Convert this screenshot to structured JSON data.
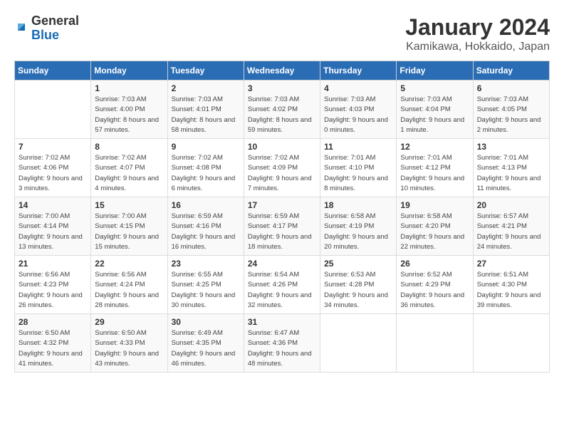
{
  "logo": {
    "text_general": "General",
    "text_blue": "Blue"
  },
  "header": {
    "month": "January 2024",
    "location": "Kamikawa, Hokkaido, Japan"
  },
  "weekdays": [
    "Sunday",
    "Monday",
    "Tuesday",
    "Wednesday",
    "Thursday",
    "Friday",
    "Saturday"
  ],
  "weeks": [
    [
      {
        "day": "",
        "sunrise": "",
        "sunset": "",
        "daylight": ""
      },
      {
        "day": "1",
        "sunrise": "Sunrise: 7:03 AM",
        "sunset": "Sunset: 4:00 PM",
        "daylight": "Daylight: 8 hours and 57 minutes."
      },
      {
        "day": "2",
        "sunrise": "Sunrise: 7:03 AM",
        "sunset": "Sunset: 4:01 PM",
        "daylight": "Daylight: 8 hours and 58 minutes."
      },
      {
        "day": "3",
        "sunrise": "Sunrise: 7:03 AM",
        "sunset": "Sunset: 4:02 PM",
        "daylight": "Daylight: 8 hours and 59 minutes."
      },
      {
        "day": "4",
        "sunrise": "Sunrise: 7:03 AM",
        "sunset": "Sunset: 4:03 PM",
        "daylight": "Daylight: 9 hours and 0 minutes."
      },
      {
        "day": "5",
        "sunrise": "Sunrise: 7:03 AM",
        "sunset": "Sunset: 4:04 PM",
        "daylight": "Daylight: 9 hours and 1 minute."
      },
      {
        "day": "6",
        "sunrise": "Sunrise: 7:03 AM",
        "sunset": "Sunset: 4:05 PM",
        "daylight": "Daylight: 9 hours and 2 minutes."
      }
    ],
    [
      {
        "day": "7",
        "sunrise": "Sunrise: 7:02 AM",
        "sunset": "Sunset: 4:06 PM",
        "daylight": "Daylight: 9 hours and 3 minutes."
      },
      {
        "day": "8",
        "sunrise": "Sunrise: 7:02 AM",
        "sunset": "Sunset: 4:07 PM",
        "daylight": "Daylight: 9 hours and 4 minutes."
      },
      {
        "day": "9",
        "sunrise": "Sunrise: 7:02 AM",
        "sunset": "Sunset: 4:08 PM",
        "daylight": "Daylight: 9 hours and 6 minutes."
      },
      {
        "day": "10",
        "sunrise": "Sunrise: 7:02 AM",
        "sunset": "Sunset: 4:09 PM",
        "daylight": "Daylight: 9 hours and 7 minutes."
      },
      {
        "day": "11",
        "sunrise": "Sunrise: 7:01 AM",
        "sunset": "Sunset: 4:10 PM",
        "daylight": "Daylight: 9 hours and 8 minutes."
      },
      {
        "day": "12",
        "sunrise": "Sunrise: 7:01 AM",
        "sunset": "Sunset: 4:12 PM",
        "daylight": "Daylight: 9 hours and 10 minutes."
      },
      {
        "day": "13",
        "sunrise": "Sunrise: 7:01 AM",
        "sunset": "Sunset: 4:13 PM",
        "daylight": "Daylight: 9 hours and 11 minutes."
      }
    ],
    [
      {
        "day": "14",
        "sunrise": "Sunrise: 7:00 AM",
        "sunset": "Sunset: 4:14 PM",
        "daylight": "Daylight: 9 hours and 13 minutes."
      },
      {
        "day": "15",
        "sunrise": "Sunrise: 7:00 AM",
        "sunset": "Sunset: 4:15 PM",
        "daylight": "Daylight: 9 hours and 15 minutes."
      },
      {
        "day": "16",
        "sunrise": "Sunrise: 6:59 AM",
        "sunset": "Sunset: 4:16 PM",
        "daylight": "Daylight: 9 hours and 16 minutes."
      },
      {
        "day": "17",
        "sunrise": "Sunrise: 6:59 AM",
        "sunset": "Sunset: 4:17 PM",
        "daylight": "Daylight: 9 hours and 18 minutes."
      },
      {
        "day": "18",
        "sunrise": "Sunrise: 6:58 AM",
        "sunset": "Sunset: 4:19 PM",
        "daylight": "Daylight: 9 hours and 20 minutes."
      },
      {
        "day": "19",
        "sunrise": "Sunrise: 6:58 AM",
        "sunset": "Sunset: 4:20 PM",
        "daylight": "Daylight: 9 hours and 22 minutes."
      },
      {
        "day": "20",
        "sunrise": "Sunrise: 6:57 AM",
        "sunset": "Sunset: 4:21 PM",
        "daylight": "Daylight: 9 hours and 24 minutes."
      }
    ],
    [
      {
        "day": "21",
        "sunrise": "Sunrise: 6:56 AM",
        "sunset": "Sunset: 4:23 PM",
        "daylight": "Daylight: 9 hours and 26 minutes."
      },
      {
        "day": "22",
        "sunrise": "Sunrise: 6:56 AM",
        "sunset": "Sunset: 4:24 PM",
        "daylight": "Daylight: 9 hours and 28 minutes."
      },
      {
        "day": "23",
        "sunrise": "Sunrise: 6:55 AM",
        "sunset": "Sunset: 4:25 PM",
        "daylight": "Daylight: 9 hours and 30 minutes."
      },
      {
        "day": "24",
        "sunrise": "Sunrise: 6:54 AM",
        "sunset": "Sunset: 4:26 PM",
        "daylight": "Daylight: 9 hours and 32 minutes."
      },
      {
        "day": "25",
        "sunrise": "Sunrise: 6:53 AM",
        "sunset": "Sunset: 4:28 PM",
        "daylight": "Daylight: 9 hours and 34 minutes."
      },
      {
        "day": "26",
        "sunrise": "Sunrise: 6:52 AM",
        "sunset": "Sunset: 4:29 PM",
        "daylight": "Daylight: 9 hours and 36 minutes."
      },
      {
        "day": "27",
        "sunrise": "Sunrise: 6:51 AM",
        "sunset": "Sunset: 4:30 PM",
        "daylight": "Daylight: 9 hours and 39 minutes."
      }
    ],
    [
      {
        "day": "28",
        "sunrise": "Sunrise: 6:50 AM",
        "sunset": "Sunset: 4:32 PM",
        "daylight": "Daylight: 9 hours and 41 minutes."
      },
      {
        "day": "29",
        "sunrise": "Sunrise: 6:50 AM",
        "sunset": "Sunset: 4:33 PM",
        "daylight": "Daylight: 9 hours and 43 minutes."
      },
      {
        "day": "30",
        "sunrise": "Sunrise: 6:49 AM",
        "sunset": "Sunset: 4:35 PM",
        "daylight": "Daylight: 9 hours and 46 minutes."
      },
      {
        "day": "31",
        "sunrise": "Sunrise: 6:47 AM",
        "sunset": "Sunset: 4:36 PM",
        "daylight": "Daylight: 9 hours and 48 minutes."
      },
      {
        "day": "",
        "sunrise": "",
        "sunset": "",
        "daylight": ""
      },
      {
        "day": "",
        "sunrise": "",
        "sunset": "",
        "daylight": ""
      },
      {
        "day": "",
        "sunrise": "",
        "sunset": "",
        "daylight": ""
      }
    ]
  ]
}
